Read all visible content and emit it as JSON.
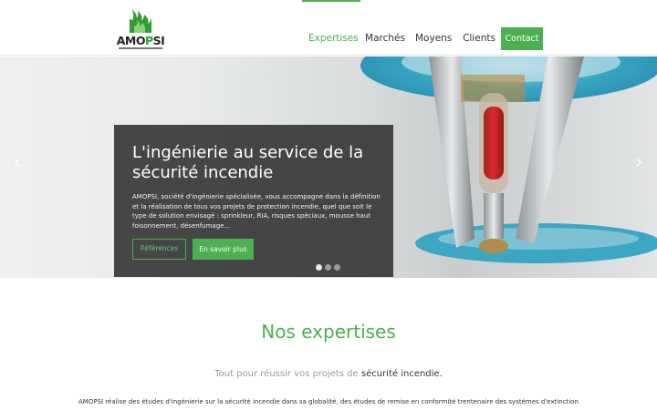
{
  "header": {
    "logo": {
      "brand_prefix": "AMO",
      "brand_mid": "P",
      "brand_suffix": "SI"
    },
    "nav": [
      {
        "label": "Expertises",
        "active": true
      },
      {
        "label": "Marchés",
        "active": false
      },
      {
        "label": "Moyens",
        "active": false
      },
      {
        "label": "Clients",
        "active": false
      }
    ],
    "contact_label": "Contact"
  },
  "colors": {
    "accent": "#4caf50",
    "caption_bg": "#373737",
    "text": "#333333"
  },
  "hero": {
    "prev_icon": "‹",
    "next_icon": "›",
    "title": "L'ingénierie au service de la sécurité incendie",
    "text": "AMOPSI, société d'ingénierie spécialisée, vous accompagne dans la définition et la réalisation de tous vos projets de protection incendie, quel que soit le type de solution envisagé : sprinkleur, RIA, risques spéciaux, mousse haut foisonnement, désenfumage...",
    "button_references": "Références",
    "button_more": "En savoir plus",
    "slides_total": 3,
    "slide_active": 1
  },
  "section": {
    "title": "Nos expertises",
    "subtitle_prefix": "Tout pour réussir vos projets de ",
    "subtitle_strong": "sécurité incendie.",
    "body": "AMOPSI réalise des études d'ingénierie sur la sécurité incendie dans sa globalité, des études de remise en conformité trentenaire des systèmes d'extinction"
  }
}
